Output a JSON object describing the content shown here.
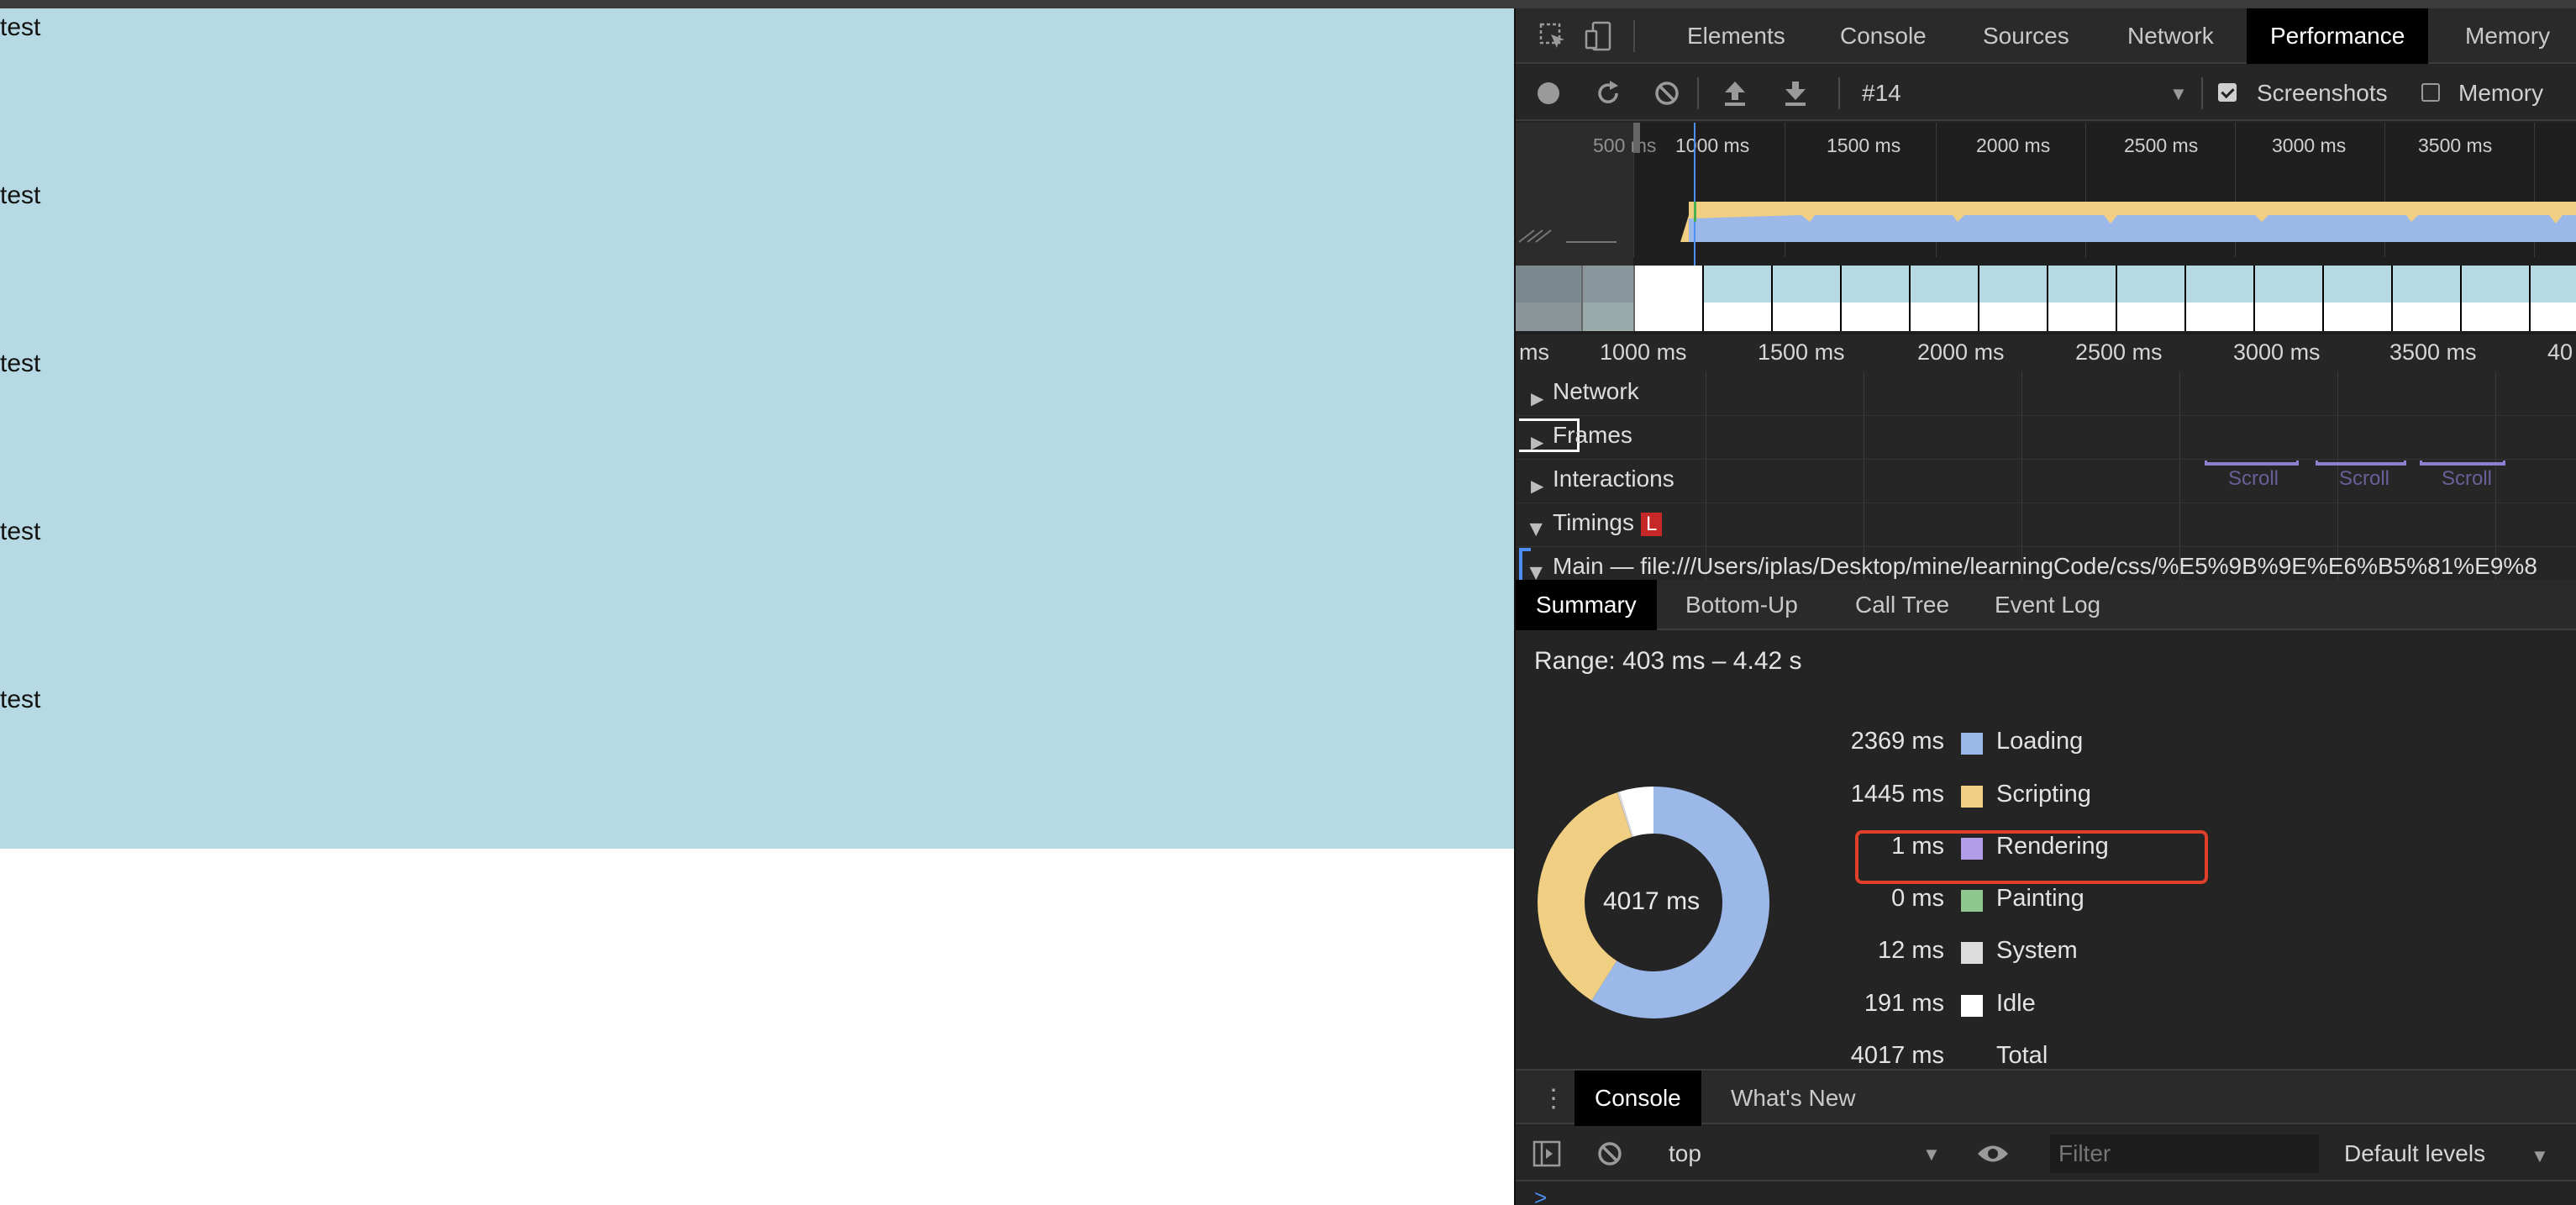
{
  "page": {
    "lines": [
      "test",
      "test",
      "test",
      "test",
      "test"
    ]
  },
  "devtools": {
    "tabs": [
      "Elements",
      "Console",
      "Sources",
      "Network",
      "Performance",
      "Memory"
    ],
    "active_tab": "Performance",
    "toolbar": {
      "profile": "#14",
      "screenshots_label": "Screenshots",
      "screenshots_checked": true,
      "memory_label": "Memory",
      "memory_checked": false
    },
    "overview_ticks": [
      "500 ms",
      "1000 ms",
      "1500 ms",
      "2000 ms",
      "2500 ms",
      "3000 ms",
      "3500 ms"
    ],
    "flame_ticks": [
      "ms",
      "1000 ms",
      "1500 ms",
      "2000 ms",
      "2500 ms",
      "3000 ms",
      "3500 ms",
      "40"
    ],
    "tracks": {
      "network": "Network",
      "frames": "Frames",
      "interactions": "Interactions",
      "timings": "Timings",
      "timings_badge": "L",
      "main": "Main — file:///Users/iplas/Desktop/mine/learningCode/css/%E5%9B%9E%E6%B5%81%E9%8"
    },
    "scroll_labels": [
      "Scroll",
      "Scroll",
      "Scroll"
    ],
    "bottom_tabs": [
      "Summary",
      "Bottom-Up",
      "Call Tree",
      "Event Log"
    ],
    "active_bottom_tab": "Summary",
    "summary": {
      "range": "Range: 403 ms – 4.42 s",
      "total_center": "4017 ms",
      "items": [
        {
          "value": "2369 ms",
          "label": "Loading",
          "color": "#9cb8e8",
          "ms": 2369
        },
        {
          "value": "1445 ms",
          "label": "Scripting",
          "color": "#f0cf82",
          "ms": 1445
        },
        {
          "value": "1 ms",
          "label": "Rendering",
          "color": "#b29ee8",
          "ms": 1
        },
        {
          "value": "0 ms",
          "label": "Painting",
          "color": "#8fc88f",
          "ms": 0
        },
        {
          "value": "12 ms",
          "label": "System",
          "color": "#dddddd",
          "ms": 12
        },
        {
          "value": "191 ms",
          "label": "Idle",
          "color": "#ffffff",
          "ms": 191
        }
      ],
      "total_value": "4017 ms",
      "total_label": "Total"
    },
    "drawer": {
      "tabs": [
        "Console",
        "What's New"
      ],
      "active": "Console",
      "context": "top",
      "filter_placeholder": "Filter",
      "levels": "Default levels"
    }
  }
}
